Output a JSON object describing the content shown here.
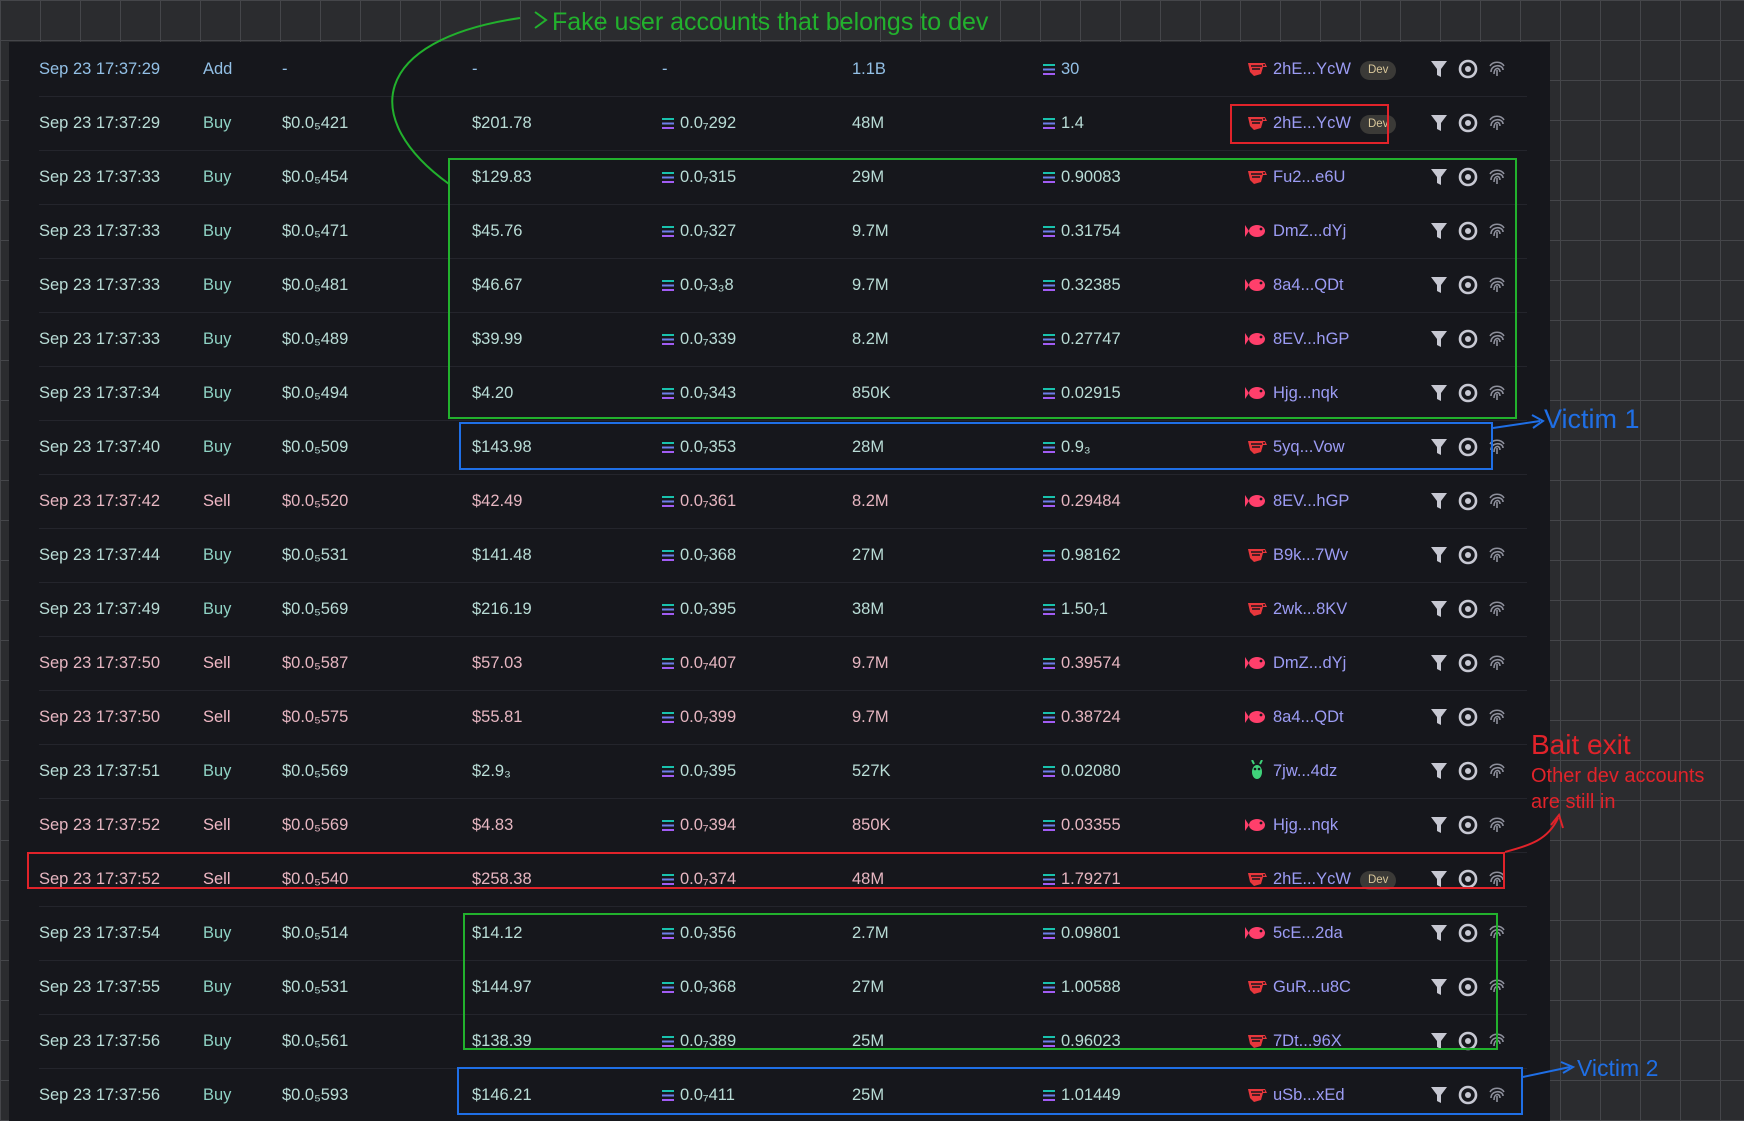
{
  "columns_count": 9,
  "colors": {
    "buy": "#b9dcd6",
    "sell": "#e6b6c1",
    "add": "#93c0e6",
    "maker": "#9c9cf4",
    "annotation_green": "#22b12d",
    "annotation_red": "#e1232a",
    "annotation_blue": "#1f6fe6"
  },
  "rows": [
    {
      "time": "Sep 23 17:37:29",
      "type": "Add",
      "price": "-",
      "usd": "-",
      "sol": "-",
      "amount": "1.1B",
      "total": "30",
      "maker": "2hE...YcW",
      "icon": "shrimp-icon",
      "dev": true
    },
    {
      "time": "Sep 23 17:37:29",
      "type": "Buy",
      "price": "$0.0₅421",
      "usd": "$201.78",
      "sol": "0.0₇292",
      "amount": "48M",
      "total": "1.4",
      "maker": "2hE...YcW",
      "icon": "shrimp-icon",
      "dev": true
    },
    {
      "time": "Sep 23 17:37:33",
      "type": "Buy",
      "price": "$0.0₅454",
      "usd": "$129.83",
      "sol": "0.0₇315",
      "amount": "29M",
      "total": "0.90083",
      "maker": "Fu2...e6U",
      "icon": "shrimp-icon",
      "dev": false
    },
    {
      "time": "Sep 23 17:37:33",
      "type": "Buy",
      "price": "$0.0₅471",
      "usd": "$45.76",
      "sol": "0.0₇327",
      "amount": "9.7M",
      "total": "0.31754",
      "maker": "DmZ...dYj",
      "icon": "fish-icon",
      "dev": false
    },
    {
      "time": "Sep 23 17:37:33",
      "type": "Buy",
      "price": "$0.0₅481",
      "usd": "$46.67",
      "sol": "0.0₇3₃8",
      "amount": "9.7M",
      "total": "0.32385",
      "maker": "8a4...QDt",
      "icon": "fish-icon",
      "dev": false
    },
    {
      "time": "Sep 23 17:37:33",
      "type": "Buy",
      "price": "$0.0₅489",
      "usd": "$39.99",
      "sol": "0.0₇339",
      "amount": "8.2M",
      "total": "0.27747",
      "maker": "8EV...hGP",
      "icon": "fish-icon",
      "dev": false
    },
    {
      "time": "Sep 23 17:37:34",
      "type": "Buy",
      "price": "$0.0₅494",
      "usd": "$4.20",
      "sol": "0.0₇343",
      "amount": "850K",
      "total": "0.02915",
      "maker": "Hjg...nqk",
      "icon": "fish-icon",
      "dev": false
    },
    {
      "time": "Sep 23 17:37:40",
      "type": "Buy",
      "price": "$0.0₅509",
      "usd": "$143.98",
      "sol": "0.0₇353",
      "amount": "28M",
      "total": "0.9₃",
      "maker": "5yq...Vow",
      "icon": "shrimp-icon",
      "dev": false
    },
    {
      "time": "Sep 23 17:37:42",
      "type": "Sell",
      "price": "$0.0₅520",
      "usd": "$42.49",
      "sol": "0.0₇361",
      "amount": "8.2M",
      "total": "0.29484",
      "maker": "8EV...hGP",
      "icon": "fish-icon",
      "dev": false
    },
    {
      "time": "Sep 23 17:37:44",
      "type": "Buy",
      "price": "$0.0₅531",
      "usd": "$141.48",
      "sol": "0.0₇368",
      "amount": "27M",
      "total": "0.98162",
      "maker": "B9k...7Wv",
      "icon": "shrimp-icon",
      "dev": false
    },
    {
      "time": "Sep 23 17:37:49",
      "type": "Buy",
      "price": "$0.0₅569",
      "usd": "$216.19",
      "sol": "0.0₇395",
      "amount": "38M",
      "total": "1.50₇1",
      "maker": "2wk...8KV",
      "icon": "shrimp-icon",
      "dev": false
    },
    {
      "time": "Sep 23 17:37:50",
      "type": "Sell",
      "price": "$0.0₅587",
      "usd": "$57.03",
      "sol": "0.0₇407",
      "amount": "9.7M",
      "total": "0.39574",
      "maker": "DmZ...dYj",
      "icon": "fish-icon",
      "dev": false
    },
    {
      "time": "Sep 23 17:37:50",
      "type": "Sell",
      "price": "$0.0₅575",
      "usd": "$55.81",
      "sol": "0.0₇399",
      "amount": "9.7M",
      "total": "0.38724",
      "maker": "8a4...QDt",
      "icon": "fish-icon",
      "dev": false
    },
    {
      "time": "Sep 23 17:37:51",
      "type": "Buy",
      "price": "$0.0₅569",
      "usd": "$2.9₃",
      "sol": "0.0₇395",
      "amount": "527K",
      "total": "0.02080",
      "maker": "7jw...4dz",
      "icon": "bug-icon",
      "dev": false
    },
    {
      "time": "Sep 23 17:37:52",
      "type": "Sell",
      "price": "$0.0₅569",
      "usd": "$4.83",
      "sol": "0.0₇394",
      "amount": "850K",
      "total": "0.03355",
      "maker": "Hjg...nqk",
      "icon": "fish-icon",
      "dev": false
    },
    {
      "time": "Sep 23 17:37:52",
      "type": "Sell",
      "price": "$0.0₅540",
      "usd": "$258.38",
      "sol": "0.0₇374",
      "amount": "48M",
      "total": "1.79271",
      "maker": "2hE...YcW",
      "icon": "shrimp-icon",
      "dev": true
    },
    {
      "time": "Sep 23 17:37:54",
      "type": "Buy",
      "price": "$0.0₅514",
      "usd": "$14.12",
      "sol": "0.0₇356",
      "amount": "2.7M",
      "total": "0.09801",
      "maker": "5cE...2da",
      "icon": "fish-icon",
      "dev": false
    },
    {
      "time": "Sep 23 17:37:55",
      "type": "Buy",
      "price": "$0.0₅531",
      "usd": "$144.97",
      "sol": "0.0₇368",
      "amount": "27M",
      "total": "1.00588",
      "maker": "GuR...u8C",
      "icon": "shrimp-icon",
      "dev": false
    },
    {
      "time": "Sep 23 17:37:56",
      "type": "Buy",
      "price": "$0.0₅561",
      "usd": "$138.39",
      "sol": "0.0₇389",
      "amount": "25M",
      "total": "0.96023",
      "maker": "7Dt...96X",
      "icon": "shrimp-icon",
      "dev": false
    },
    {
      "time": "Sep 23 17:37:56",
      "type": "Buy",
      "price": "$0.0₅593",
      "usd": "$146.21",
      "sol": "0.0₇411",
      "amount": "25M",
      "total": "1.01449",
      "maker": "uSb...xEd",
      "icon": "shrimp-icon",
      "dev": false
    }
  ],
  "dev_label": "Dev",
  "row_actions": [
    "filter-icon",
    "target-icon",
    "fingerprint-icon"
  ],
  "annotations": {
    "fake_accounts": "Fake user accounts that belongs to dev",
    "victim1": "Victim 1",
    "victim2": "Victim 2",
    "bait_exit_title": "Bait exit",
    "bait_exit_line1": "Other dev accounts",
    "bait_exit_line2": "are still in"
  }
}
